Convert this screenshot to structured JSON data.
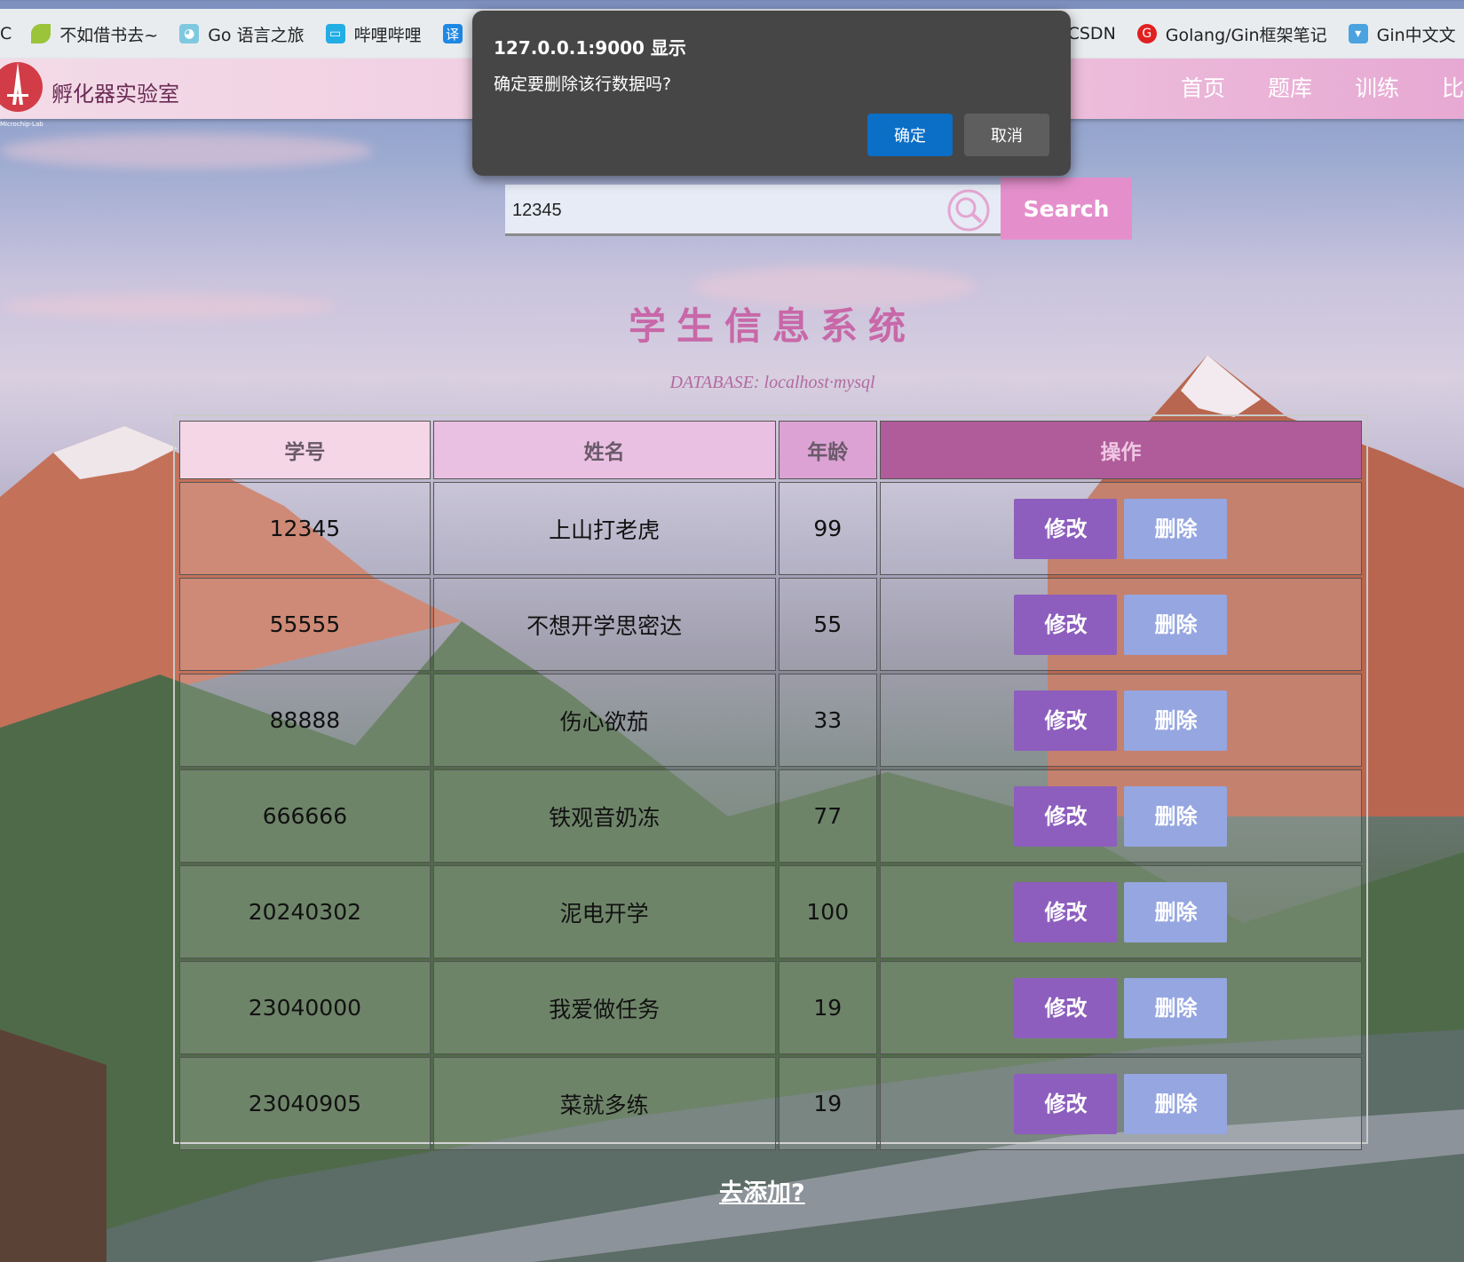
{
  "bookmarks": [
    {
      "label": "C",
      "icon": "c-icon"
    },
    {
      "label": "不如借书去~",
      "icon": "leaf-icon"
    },
    {
      "label": "Go 语言之旅",
      "icon": "gopher-icon"
    },
    {
      "label": "哔哩哔哩",
      "icon": "bilibili-icon"
    },
    {
      "label": "译",
      "icon": "translate-icon"
    },
    {
      "label": "CSDN",
      "icon": "csdn-icon"
    },
    {
      "label": "Golang/Gin框架笔记",
      "icon": "g-icon"
    },
    {
      "label": "Gin中文文",
      "icon": "cup-icon"
    }
  ],
  "header": {
    "brand": "孵化器实验室",
    "brand_sub": "Microchip-Lab",
    "nav": [
      "首页",
      "题库",
      "训练",
      "比"
    ]
  },
  "search": {
    "value": "12345",
    "button": "Search"
  },
  "page": {
    "title": "学生信息系统",
    "subtitle": "DATABASE: localhost·mysql"
  },
  "table": {
    "headers": [
      "学号",
      "姓名",
      "年龄",
      "操作"
    ],
    "edit_label": "修改",
    "delete_label": "删除",
    "rows": [
      {
        "id": "12345",
        "name": "上山打老虎",
        "age": "99"
      },
      {
        "id": "55555",
        "name": "不想开学思密达",
        "age": "55"
      },
      {
        "id": "88888",
        "name": "伤心欲茄",
        "age": "33"
      },
      {
        "id": "666666",
        "name": "铁观音奶冻",
        "age": "77"
      },
      {
        "id": "20240302",
        "name": "泥电开学",
        "age": "100"
      },
      {
        "id": "23040000",
        "name": "我爱做任务",
        "age": "19"
      },
      {
        "id": "23040905",
        "name": "菜就多练",
        "age": "19"
      }
    ]
  },
  "add_link": "去添加?",
  "dialog": {
    "title": "127.0.0.1:9000 显示",
    "message": "确定要删除该行数据吗?",
    "ok": "确定",
    "cancel": "取消"
  },
  "colors": {
    "accent": "#e48fcb",
    "edit_button": "#8d5ebd",
    "delete_button": "#95a6e0",
    "dialog_ok": "#0b6fc7"
  }
}
